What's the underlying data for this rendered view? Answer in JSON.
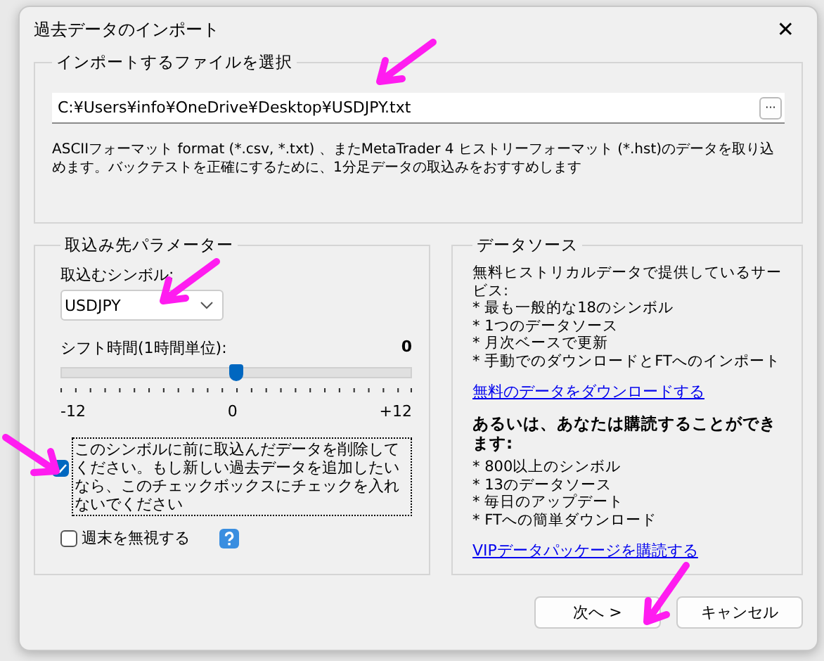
{
  "window": {
    "title": "過去データのインポート",
    "close": "✕"
  },
  "file_group": {
    "title": "インポートするファイルを選択",
    "path": "C:¥Users¥info¥OneDrive¥Desktop¥USDJPY.txt",
    "browse": "···",
    "description": "ASCIIフォーマット format (*.csv, *.txt) 、またMetaTrader 4 ヒストリーフォーマット (*.hst)のデータを取り込めます。バックテストを正確にするために、1分足データの取込みをおすすめします"
  },
  "params": {
    "title": "取込み先パラメーター",
    "symbol_label": "取込むシンボル:",
    "symbol": "USDJPY",
    "shift_label": "シフト時間(1時間単位):",
    "shift_value": "0",
    "shift": {
      "level": 0.5,
      "min": "-12",
      "mid": "0",
      "max": "+12"
    },
    "options": [
      {
        "label": "このシンボルに前に取込んだデータを削除してください。もし新しい過去データを追加したいなら、このチェックボックスにチェックを入れないでください",
        "checked": true,
        "focused": true,
        "kind": "plain"
      },
      {
        "label": "週末を無視する",
        "checked": false,
        "focused": false,
        "kind": "help"
      }
    ]
  },
  "datasource": {
    "title": "データソース",
    "free_heading": "無料ヒストリカルデータで提供しているサービス:",
    "free_items": [
      "* 最も一般的な18のシンボル",
      "* 1つのデータソース",
      "* 月次ベースで更新",
      "* 手動でのダウンロードとFTへのインポート"
    ],
    "free_link": "無料のデータをダウンロードする",
    "paid_heading": "あるいは、あなたは購読することができます:",
    "paid_items": [
      "* 800以上のシンボル",
      "* 13のデータソース",
      "* 毎日のアップデート",
      "* FTへの簡単ダウンロード"
    ],
    "paid_link": "VIPデータパッケージを購読する"
  },
  "buttons": [
    "次へ >",
    "キャンセル"
  ]
}
